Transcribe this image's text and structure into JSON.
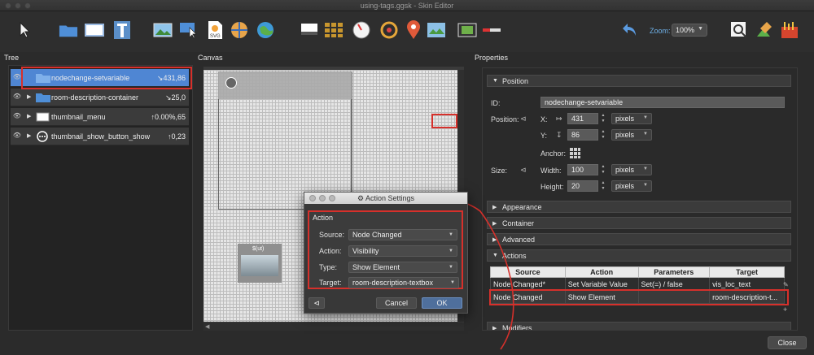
{
  "window": {
    "title": "using-tags.ggsk - Skin Editor"
  },
  "toolbar": {
    "tools": [
      "pointer-tool",
      "folder-tool",
      "rectangle-tool",
      "text-tool",
      "image-tool",
      "hotspot-tool",
      "svg-tool",
      "polygon-tool",
      "globe-tool",
      "cloner-tool",
      "grid-tool",
      "compass-tool",
      "target-tool",
      "pin-tool",
      "map-tool",
      "video-tool",
      "scrollbar-tool",
      "undo-tool",
      "magnifier-tool",
      "paint-tool",
      "toolbox-tool"
    ],
    "zoom_label": "Zoom:",
    "zoom_value": "100%"
  },
  "panels": {
    "tree": "Tree",
    "canvas": "Canvas",
    "properties": "Properties"
  },
  "tree": {
    "rows": [
      {
        "name": "nodechange-setvariable",
        "coord": "↘431,86"
      },
      {
        "name": "room-description-container",
        "coord": "↘25,0"
      },
      {
        "name": "thumbnail_menu",
        "coord": "↑0.00%,65"
      },
      {
        "name": "thumbnail_show_button_show",
        "coord": "↑0,23"
      }
    ]
  },
  "canvas": {
    "thumb_label": "$(ut)"
  },
  "properties": {
    "position_section": "Position",
    "id_label": "ID:",
    "id_value": "nodechange-setvariable",
    "position_label": "Position:",
    "x_label": "X:",
    "x_value": "431",
    "y_label": "Y:",
    "y_value": "86",
    "units": "pixels",
    "anchor_label": "Anchor:",
    "size_label": "Size:",
    "width_label": "Width:",
    "width_value": "100",
    "height_label": "Height:",
    "height_value": "20",
    "sections": [
      "Appearance",
      "Container",
      "Advanced",
      "Actions"
    ],
    "modifiers_section": "Modifiers",
    "actions_table": {
      "headers": [
        "Source",
        "Action",
        "Parameters",
        "Target"
      ],
      "rows": [
        [
          "Node Changed*",
          "Set Variable Value",
          "Set(=) / false",
          "vis_loc_text"
        ],
        [
          "Node Changed",
          "Show Element",
          "",
          "room-description-t..."
        ]
      ]
    }
  },
  "dialog": {
    "title": "Action Settings",
    "group_label": "Action",
    "source_label": "Source:",
    "source_value": "Node Changed",
    "action_label": "Action:",
    "action_value": "Visibility",
    "type_label": "Type:",
    "type_value": "Show Element",
    "target_label": "Target:",
    "target_value": "room-description-textbox",
    "cancel_label": "Cancel",
    "ok_label": "OK"
  },
  "footer": {
    "close_label": "Close"
  },
  "colors": {
    "accent": "#4f86d3",
    "highlight": "#d6302b",
    "zoom_text": "#6fb2ea"
  }
}
